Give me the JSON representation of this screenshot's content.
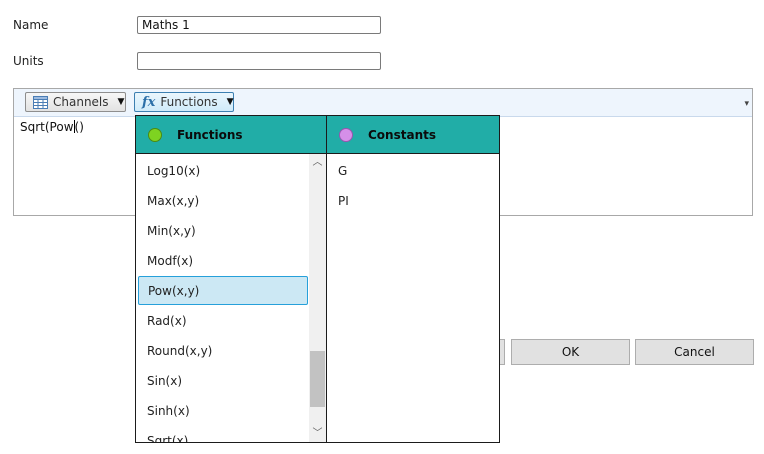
{
  "form": {
    "name_label": "Name",
    "name_value": "Maths 1",
    "units_label": "Units",
    "units_value": ""
  },
  "editor": {
    "toolbar": {
      "channels_label": "Channels",
      "functions_label": "Functions"
    },
    "expression_before_caret": "Sqrt(Pow",
    "expression_after_caret": "()"
  },
  "functions_panel": {
    "title": "Functions",
    "dot_color": "#7ed321",
    "items": [
      "Log10(x)",
      "Max(x,y)",
      "Min(x,y)",
      "Modf(x)",
      "Pow(x,y)",
      "Rad(x)",
      "Round(x,y)",
      "Sin(x)",
      "Sinh(x)",
      "Sqrt(x)"
    ],
    "selected_item": "Pow(x,y)"
  },
  "constants_panel": {
    "title": "Constants",
    "dot_color": "#d58fe8",
    "items": [
      "G",
      "PI"
    ]
  },
  "buttons": {
    "ok_label": "OK",
    "cancel_label": "Cancel"
  },
  "colors": {
    "panel_header": "#21ada7",
    "selection": "#cce8f4",
    "toolbar": "#eef5fd"
  }
}
